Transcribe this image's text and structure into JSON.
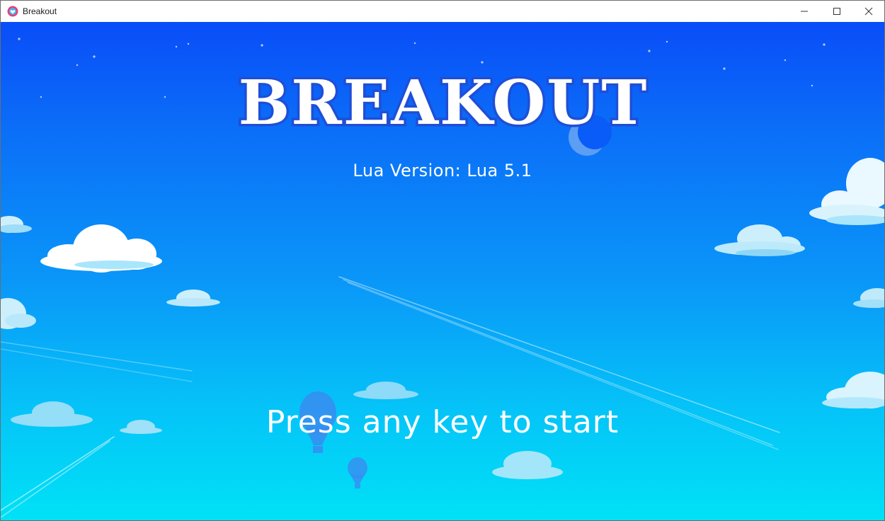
{
  "window": {
    "title": "Breakout",
    "icon": "heart-app-icon",
    "controls": {
      "minimize": "minimize-icon",
      "maximize": "maximize-icon",
      "close": "close-icon"
    }
  },
  "game": {
    "title": "BREAKOUT",
    "version_text": "Lua Version: Lua 5.1",
    "prompt": "Press any key to start",
    "colors": {
      "sky_top": "#0a4df8",
      "sky_bottom": "#00e2f6",
      "title_fill": "#ffffff",
      "title_outline": "#1f4fd6",
      "cloud": "#ffffff",
      "cloud_shade": "#a9e6fb",
      "balloon": "#3a8cf0"
    }
  }
}
